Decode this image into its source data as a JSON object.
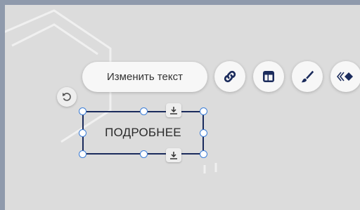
{
  "toolbar": {
    "edit_text_label": "Изменить текст",
    "buttons": [
      {
        "icon": "link-icon"
      },
      {
        "icon": "layout-icon"
      },
      {
        "icon": "brush-icon"
      },
      {
        "icon": "animation-icon"
      }
    ]
  },
  "element": {
    "text": "ПОДРОБНЕЕ"
  },
  "colors": {
    "frame": "#8f9aac",
    "canvas": "#dcdcdc",
    "selection_border": "#1b2b5c",
    "handle_border": "#3d7fd9",
    "pill": "#f7f7f7"
  }
}
